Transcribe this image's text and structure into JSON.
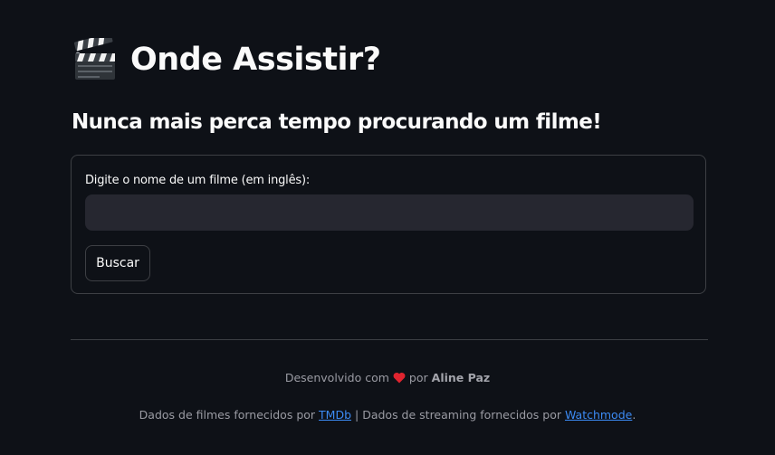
{
  "header": {
    "title": "Onde Assistir?",
    "icon": "clapper-board-icon",
    "subtitle": "Nunca mais perca tempo procurando um filme!"
  },
  "form": {
    "label": "Digite o nome de um filme (em inglês):",
    "input_value": "",
    "input_placeholder": "",
    "button_label": "Buscar"
  },
  "footer": {
    "credit_prefix": "Desenvolvido com",
    "heart_icon": "heart-icon",
    "credit_by": "por",
    "author": "Aline Paz",
    "sources_prefix": "Dados de filmes fornecidos por",
    "tmdb_link": "TMDb",
    "separator": "|",
    "sources_middle": "Dados de streaming fornecidos por",
    "watchmode_link": "Watchmode",
    "sources_suffix": "."
  },
  "colors": {
    "background": "#0e1117",
    "input_background": "#262730",
    "text": "#fafafa",
    "muted_text": "#9a9ba3",
    "link": "#3c8bf5",
    "heart": "#e0242f"
  }
}
